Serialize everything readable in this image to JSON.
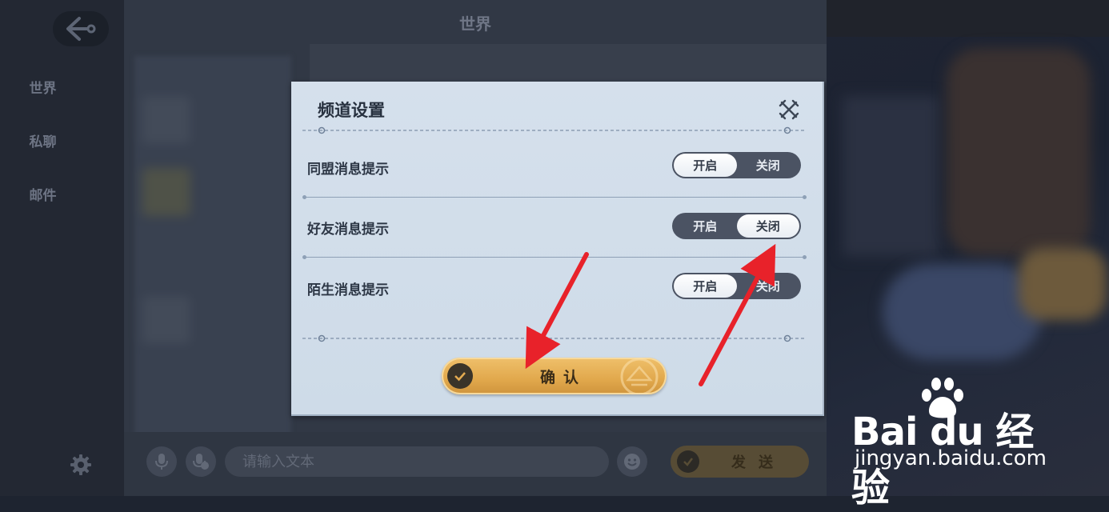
{
  "app": {
    "top_title": "世界"
  },
  "sidebar": {
    "items": [
      {
        "label": "世界"
      },
      {
        "label": "私聊"
      },
      {
        "label": "邮件"
      }
    ],
    "back_icon": "back-arrow-icon",
    "settings_icon": "gear-icon"
  },
  "chat_bar": {
    "input_placeholder": "请输入文本",
    "send_label": "发送",
    "voice_icon": "microphone-icon",
    "team_voice_icon": "microphone-team-icon",
    "emoji_icon": "emoji-icon"
  },
  "dialog": {
    "title": "频道设置",
    "close_icon": "crossed-swords-close-icon",
    "rows": [
      {
        "label": "同盟消息提示",
        "on_label": "开启",
        "off_label": "关闭",
        "selected": "on"
      },
      {
        "label": "好友消息提示",
        "on_label": "开启",
        "off_label": "关闭",
        "selected": "off"
      },
      {
        "label": "陌生消息提示",
        "on_label": "开启",
        "off_label": "关闭",
        "selected": "on"
      }
    ],
    "confirm_label": "确认"
  },
  "annotations": {
    "arrow_color": "#e8222a"
  },
  "watermark": {
    "brand": "Bai du 经验",
    "url": "jingyan.baidu.com"
  },
  "colors": {
    "dialog_bg": "#d3dfeb",
    "toggle_dark": "#4b5363",
    "confirm_gold": "#e3ab50"
  }
}
